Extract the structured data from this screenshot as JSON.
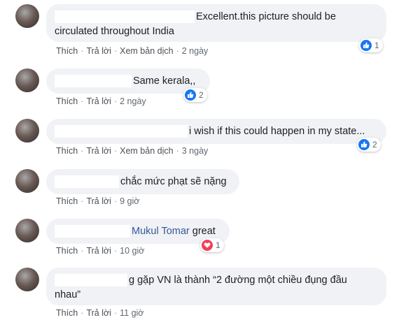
{
  "actions": {
    "like": "Thích",
    "reply": "Trả lời",
    "translate": "Xem bản dịch"
  },
  "comments": [
    {
      "text_line1": "Excellent.this picture should be",
      "text_line2": "circulated throughout India",
      "time": "2 ngày",
      "reaction_type": "like",
      "reaction_count": "1"
    },
    {
      "text_line1": "Same kerala,,",
      "time": "2 ngày",
      "reaction_type": "like",
      "reaction_count": "2"
    },
    {
      "text_line1": "i wish if this could happen in my state...",
      "time": "3 ngày",
      "reaction_type": "like",
      "reaction_count": "2"
    },
    {
      "text_line1": "chắc mức phạt sẽ nặng",
      "time": "9 giờ"
    },
    {
      "mention": "Mukul Tomar",
      "text_line1": " great",
      "time": "10 giờ",
      "reaction_type": "love",
      "reaction_count": "1"
    },
    {
      "text_line1": "g gặp VN là thành “2 đường một chiều đụng đầu",
      "text_line2": "nhau”",
      "time": "11 giờ"
    }
  ],
  "colors": {
    "bubble_bg": "#f0f2f5",
    "like_blue": "#1877f2",
    "love_red": "#f33e58",
    "link_blue": "#385898"
  }
}
